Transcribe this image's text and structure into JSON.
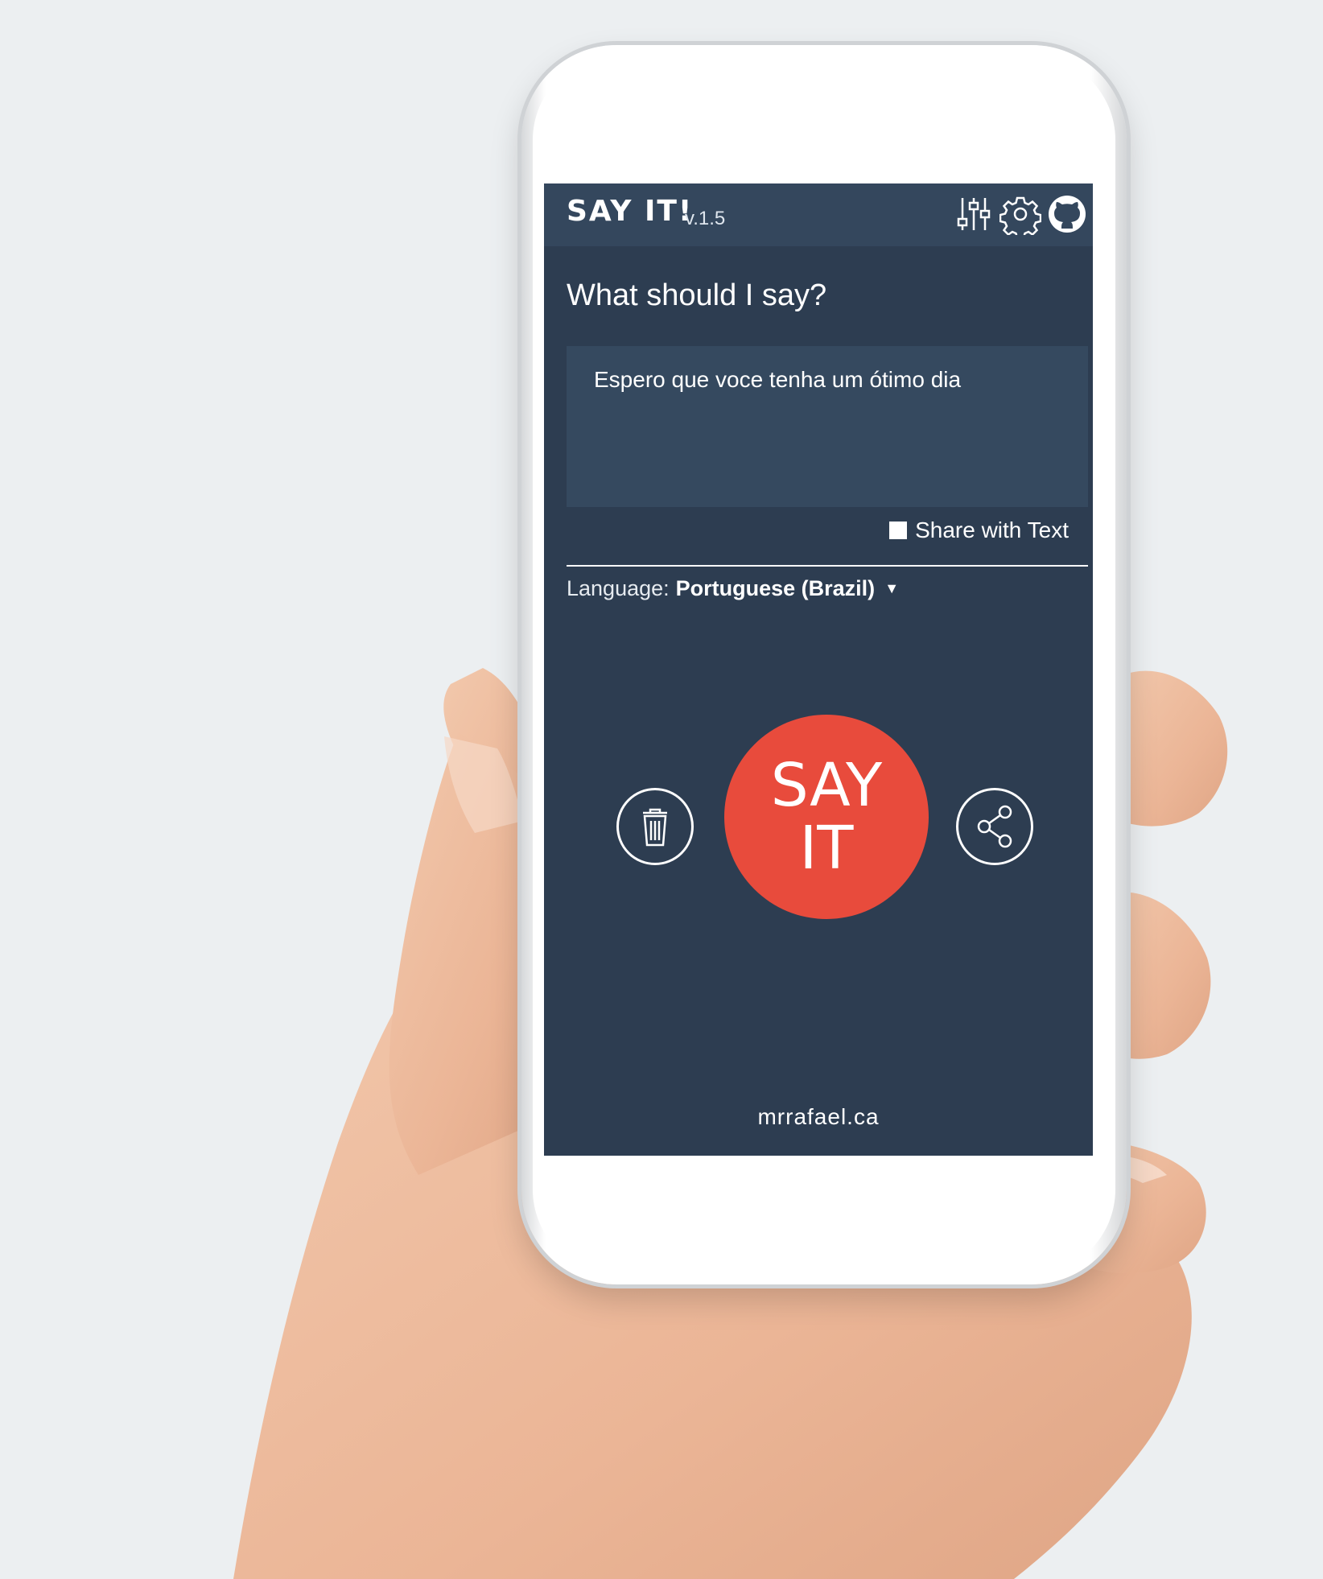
{
  "header": {
    "title": "SAY IT!",
    "version": "v.1.5",
    "icons": [
      "sliders-icon",
      "gear-icon",
      "github-icon"
    ]
  },
  "main": {
    "prompt": "What should I say?",
    "input_value": "Espero que voce tenha um ótimo dia",
    "share_with_text": {
      "label": "Share with Text",
      "checked": false
    },
    "language": {
      "label": "Language:",
      "value": "Portuguese (Brazil)"
    },
    "say_button": {
      "line1": "SAY",
      "line2": "IT"
    },
    "actions": [
      "trash-icon",
      "share-icon"
    ]
  },
  "footer": {
    "link": "mrrafael.ca"
  },
  "colors": {
    "screen_bg": "#2d3d51",
    "topbar_bg": "#34475d",
    "input_bg": "#35495f",
    "say_button": "#e84b3c",
    "page_bg": "#eceff1"
  }
}
